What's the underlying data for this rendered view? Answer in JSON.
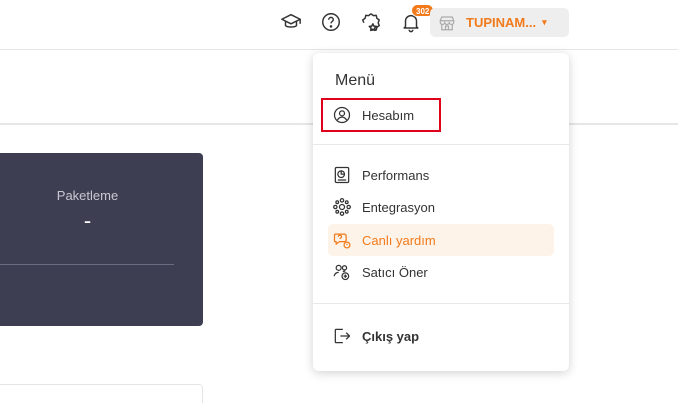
{
  "header": {
    "notification_count": "302",
    "store_name": "TUPINAM...",
    "store_caret": "▾"
  },
  "stats_card": {
    "title": "Paketleme",
    "value": "-"
  },
  "user_menu": {
    "title": "Menü",
    "items": [
      {
        "label": "Hesabım",
        "icon": "user-circle-icon"
      },
      {
        "label": "Performans",
        "icon": "performance-icon"
      },
      {
        "label": "Entegrasyon",
        "icon": "integration-icon"
      },
      {
        "label": "Canlı yardım",
        "icon": "live-help-icon"
      },
      {
        "label": "Satıcı Öner",
        "icon": "add-user-icon"
      },
      {
        "label": "Çıkış yap",
        "icon": "logout-icon"
      }
    ]
  },
  "colors": {
    "accent": "#f27a1a",
    "card_bg": "#3e3e53",
    "highlight": "#e0001a"
  }
}
